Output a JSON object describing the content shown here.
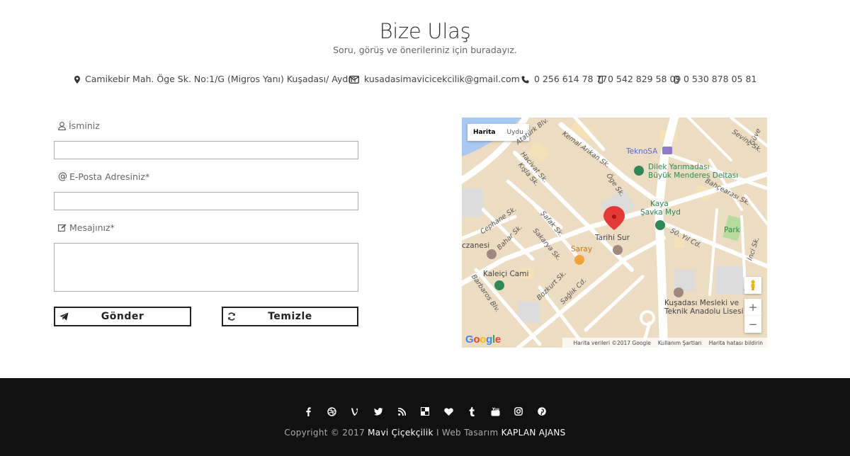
{
  "header": {
    "title": "Bize Ulaş",
    "subtitle": "Soru, görüş ve önerileriniz için buradayız."
  },
  "contact": {
    "address": "Camikebir Mah. Öge Sk. No:1/G (Migros Yanı) Kuşadası/ Aydın",
    "email": "kusadasimavicicekcilik@gmail.com",
    "phone": "0 256 614 78 77",
    "mobile1": "0 542 829 58 09",
    "mobile2": "0 530 878 05 81"
  },
  "form": {
    "name_label": "İsminiz",
    "email_label": "E-Posta Adresiniz*",
    "message_label": "Mesajınız*",
    "name_value": "",
    "email_value": "",
    "message_value": "",
    "submit_label": "Gönder",
    "clear_label": "Temizle"
  },
  "map": {
    "tab_map": "Harita",
    "tab_satellite": "Uydu",
    "labels": {
      "ataturk": "Atatürk Blv.",
      "kemal": "Kemal Arıkan Sk.",
      "hacivat": "Hacivat Sk.",
      "kisla": "Kışla Sk.",
      "teknosa": "TeknoSA",
      "dilek1": "Dilek Yarımadası",
      "dilek2": "Büyük Menderes Deltası",
      "sevinc": "Sevinç Sk.",
      "bahcearasi": "Bahçearası Sk.",
      "kaya1": "Kaya",
      "kaya2": "Şavka Myd",
      "oge": "Öge Sk.",
      "cephane": "Cephane Sk.",
      "bahar": "Bahar Sk.",
      "safak": "Şafak Sk.",
      "sakarya": "Sakarya Sk.",
      "tarihi": "Tarihi Sur",
      "saray": "Saray",
      "eczanesi": "czanesi",
      "kaleici": "Kaleiçi Cami",
      "barbaros": "Barbaros Blv.",
      "bozkurt": "Bozkurt Sk.",
      "saglik": "Sağlık Cd.",
      "yil50": "50. Yıl Cd.",
      "park": "Park",
      "inci": "İnci Sk.",
      "meslek1": "Kuşadası Mesleki ve",
      "meslek2": "Teknik Anadolu Lisesi",
      "guven": "Güve"
    },
    "zoom_in": "+",
    "zoom_out": "−",
    "google": "Google",
    "attr_data": "Harita verileri ©2017 Google",
    "attr_terms": "Kullanım Şartları",
    "attr_report": "Harita hatası bildirin"
  },
  "footer": {
    "social_icons": [
      "facebook-icon",
      "dribbble-icon",
      "vine-icon",
      "twitter-icon",
      "rss-icon",
      "delicious-icon",
      "heart-icon",
      "tumblr-icon",
      "youtube-icon",
      "instagram-icon",
      "pinterest-icon"
    ],
    "copyright_prefix": "Copyright © 2017",
    "company": "Mavi Çiçekçilik",
    "separator": "I Web Tasarım",
    "agency": "KAPLAN AJANS"
  },
  "colors": {
    "footer_bg": "#111111",
    "map_pin": "#e53935",
    "map_green": "#2d8a56"
  }
}
